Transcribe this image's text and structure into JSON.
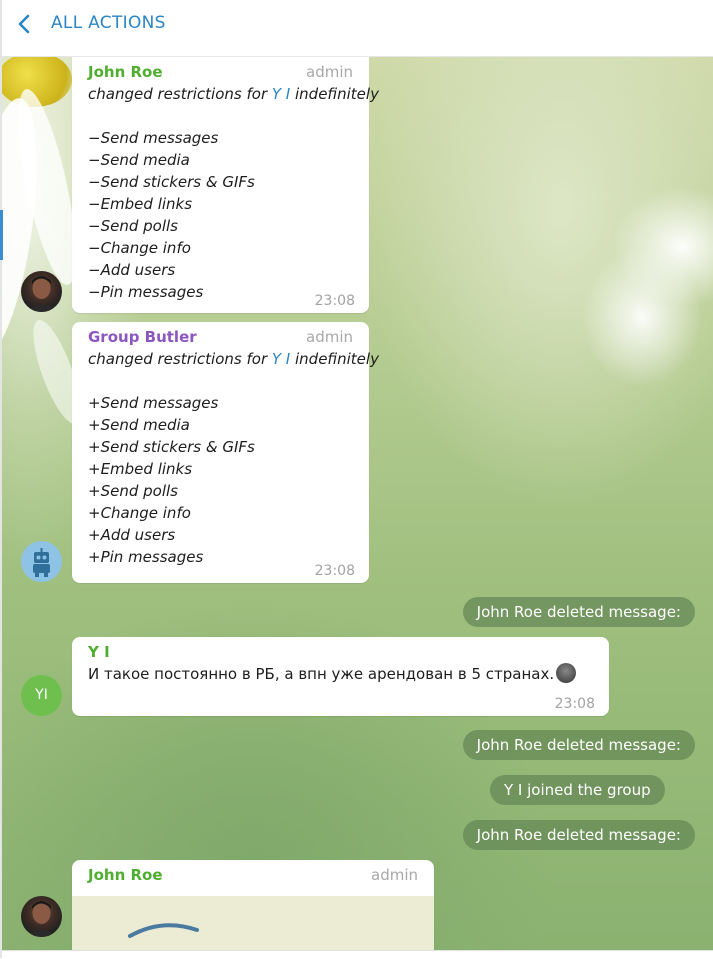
{
  "header": {
    "back_label": "ALL ACTIONS",
    "back_icon": "chevron-left-icon"
  },
  "messages": [
    {
      "sender": "John Roe",
      "role": "admin",
      "action_prefix": "changed restrictions for ",
      "target": "Y I",
      "action_suffix": " indefinitely",
      "items": [
        "−Send messages",
        "−Send media",
        "−Send stickers & GIFs",
        "−Embed links",
        "−Send polls",
        "−Change info",
        "−Add users",
        "−Pin messages"
      ],
      "time": "23:08"
    },
    {
      "sender": "Group Butler",
      "role": "admin",
      "action_prefix": "changed restrictions for ",
      "target": "Y I",
      "action_suffix": " indefinitely",
      "items": [
        "+Send messages",
        "+Send media",
        "+Send stickers & GIFs",
        "+Embed links",
        "+Send polls",
        "+Change info",
        "+Add users",
        "+Pin messages"
      ],
      "time": "23:08"
    },
    {
      "sender": "Y I",
      "avatar_initials": "YI",
      "text": "И такое постоянно в РБ, а впн уже арендован в 5 странах.",
      "time": "23:08"
    },
    {
      "sender": "John Roe",
      "role": "admin"
    }
  ],
  "service": {
    "deleted_1": "John Roe deleted message:",
    "deleted_2": "John Roe deleted message:",
    "joined": "Y I joined the group",
    "deleted_3": "John Roe deleted message:"
  },
  "colors": {
    "accent": "#2b86c5",
    "sender_green": "#4fad2f",
    "sender_purple": "#8c56c0",
    "avatar_yi": "#6fbf4f"
  }
}
